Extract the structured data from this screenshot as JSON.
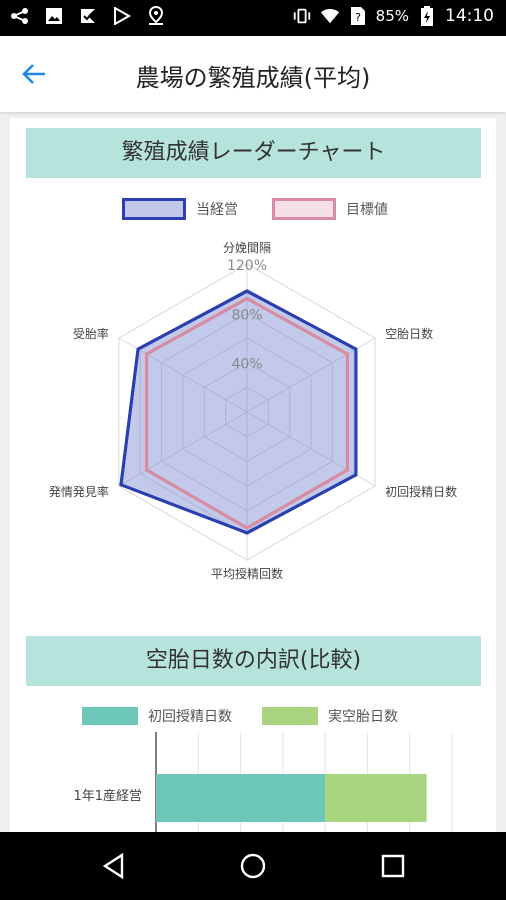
{
  "status_bar": {
    "battery_percent": "85%",
    "time": "14:10",
    "icons_left": [
      "share-icon",
      "image-icon",
      "flag-icon",
      "play-store-icon",
      "location-icon"
    ],
    "icons_right": [
      "vibrate-icon",
      "wifi-icon",
      "no-sim-icon",
      "battery-charging-icon"
    ]
  },
  "app_bar": {
    "title": "農場の繁殖成績(平均)",
    "back_icon": "arrow-back-icon",
    "accent_color": "#1e88e5"
  },
  "radar_section": {
    "title": "繁殖成績レーダーチャート",
    "legend": [
      {
        "label": "当経営",
        "color": "#2a3fb0"
      },
      {
        "label": "目標値",
        "color": "#d98ca0"
      }
    ]
  },
  "bar_section": {
    "title": "空胎日数の内訳(比較)",
    "legend": [
      {
        "label": "初回授精日数",
        "color": "#6cc7b8"
      },
      {
        "label": "実空胎日数",
        "color": "#a9d47f"
      }
    ]
  },
  "chart_data": [
    {
      "type": "radar",
      "axes": [
        "分娩間隔",
        "空胎日数",
        "初回授精日数",
        "平均授精回数",
        "発情発見率",
        "受胎率"
      ],
      "ticks": [
        "40%",
        "80%",
        "120%"
      ],
      "range": [
        0,
        120
      ],
      "series": [
        {
          "name": "当経営",
          "values": [
            98,
            102,
            102,
            98,
            118,
            102
          ],
          "color": "#2a3fb0"
        },
        {
          "name": "目標値",
          "values": [
            92,
            94,
            94,
            94,
            94,
            94
          ],
          "color": "#d98ca0"
        }
      ]
    },
    {
      "type": "bar",
      "orientation": "horizontal",
      "stacked": true,
      "categories": [
        "1年1産経営"
      ],
      "series": [
        {
          "name": "初回授精日数",
          "values": [
            60
          ]
        },
        {
          "name": "実空胎日数",
          "values": [
            36
          ]
        }
      ],
      "xlim": [
        0,
        105
      ]
    }
  ],
  "nav_bar": {
    "buttons": [
      "back-triangle-icon",
      "home-circle-icon",
      "recents-square-icon"
    ]
  }
}
